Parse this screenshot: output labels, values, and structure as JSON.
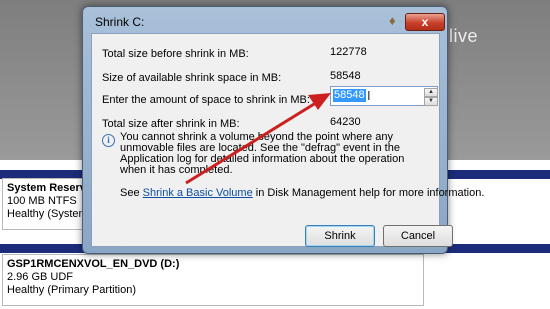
{
  "watermark": {
    "line1": "peter  live",
    "line2": "  ..."
  },
  "dialog": {
    "title": "Shrink C:",
    "close_label": "x",
    "total_size_label": "Total size before shrink in MB:",
    "total_size_value": "122778",
    "available_label": "Size of available shrink space in MB:",
    "available_value": "58548",
    "amount_label": "Enter the amount of space to shrink in MB:",
    "amount_value": "58548",
    "after_label": "Total size after shrink in MB:",
    "after_value": "64230",
    "info_text": "You cannot shrink a volume beyond the point where any unmovable files are located. See the \"defrag\" event in the Application log for detailed information about the operation when it has completed.",
    "see_prefix": "See ",
    "see_link": "Shrink a Basic Volume",
    "see_suffix": " in Disk Management help for more information.",
    "shrink_button": "Shrink",
    "cancel_button": "Cancel"
  },
  "volumes": [
    {
      "name": "System Reserved",
      "size": "100 MB NTFS",
      "status": "Healthy (System, A"
    },
    {
      "name": "GSP1RMCENXVOL_EN_DVD  (D:)",
      "size": "2.96 GB UDF",
      "status": "Healthy (Primary Partition)"
    }
  ],
  "colors": {
    "arrow": "#cc1f1f",
    "disk_strip": "#1c2c7a",
    "selection": "#3399ff"
  }
}
